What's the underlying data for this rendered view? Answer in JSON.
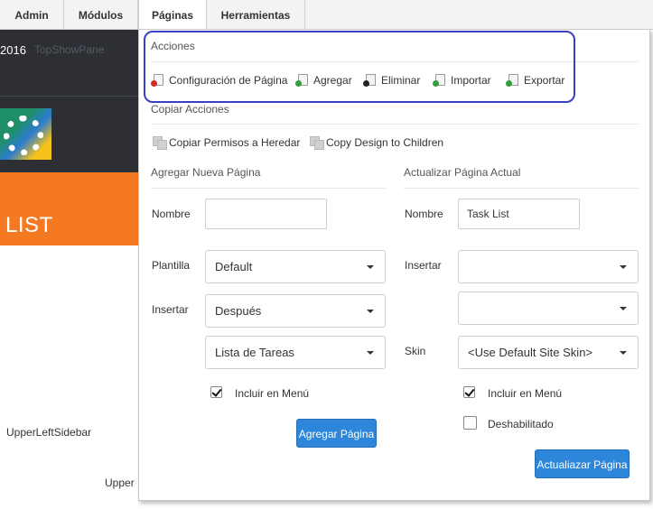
{
  "topbar": {
    "items": [
      {
        "label": "Admin"
      },
      {
        "label": "Módulos"
      },
      {
        "label": "Páginas"
      },
      {
        "label": "Herramientas"
      }
    ]
  },
  "background": {
    "year": "2016",
    "pane": "TopShowPane",
    "page_title": "LIST",
    "upper_left": "UpperLeftSidebar",
    "upper": "Upper"
  },
  "panel": {
    "acciones": {
      "title": "Acciones",
      "items": [
        {
          "label": "Configuración de Página",
          "icon": "page-settings-icon"
        },
        {
          "label": "Agregar",
          "icon": "add-page-icon"
        },
        {
          "label": "Eliminar",
          "icon": "delete-page-icon"
        },
        {
          "label": "Importar",
          "icon": "import-page-icon"
        },
        {
          "label": "Exportar",
          "icon": "export-page-icon"
        }
      ]
    },
    "copiar": {
      "title": "Copiar Acciones",
      "items": [
        {
          "label": "Copiar Permisos a Heredar",
          "icon": "copy-permissions-icon"
        },
        {
          "label": "Copy Design to Children",
          "icon": "copy-design-icon"
        }
      ]
    },
    "agregar": {
      "title": "Agregar Nueva Página",
      "nombre_label": "Nombre",
      "nombre_value": "",
      "plantilla_label": "Plantilla",
      "plantilla_value": "Default",
      "insertar_label": "Insertar",
      "insertar_value": "Después",
      "insertar_page": "Lista de Tareas",
      "incluir_label": "Incluir en Menú",
      "incluir_checked": true,
      "button": "Agregar Página"
    },
    "actualizar": {
      "title": "Actualizar Página Actual",
      "nombre_label": "Nombre",
      "nombre_value": "Task List",
      "insertar_label": "Insertar",
      "insertar_value": "",
      "insertar_page": "",
      "skin_label": "Skin",
      "skin_value": "<Use Default Site Skin>",
      "incluir_label": "Incluir en Menú",
      "incluir_checked": true,
      "deshabilitado_label": "Deshabilitado",
      "deshabilitado_checked": false,
      "button": "Actualiazar Página"
    }
  },
  "colors": {
    "accent_button": "#2d86d9",
    "highlight_border": "#3a3fc4",
    "orange_banner": "#f47920",
    "dark_header": "#2d2f34"
  }
}
